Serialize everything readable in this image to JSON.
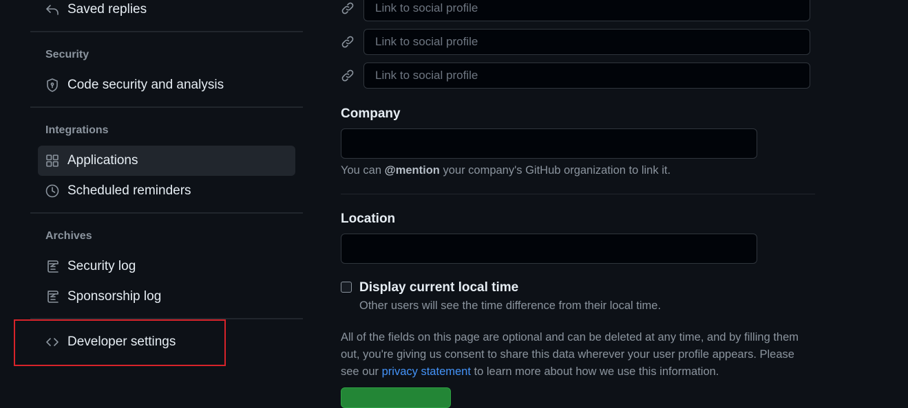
{
  "sidebar": {
    "saved_replies": "Saved replies",
    "sections": {
      "security": {
        "heading": "Security",
        "items": [
          "Code security and analysis"
        ]
      },
      "integrations": {
        "heading": "Integrations",
        "items": [
          "Applications",
          "Scheduled reminders"
        ]
      },
      "archives": {
        "heading": "Archives",
        "items": [
          "Security log",
          "Sponsorship log"
        ]
      }
    },
    "developer_settings": "Developer settings",
    "active_item": "Applications"
  },
  "profile": {
    "social_placeholder": "Link to social profile",
    "company": {
      "label": "Company",
      "help_prefix": "You can ",
      "help_mention": "@mention",
      "help_suffix": " your company's GitHub organization to link it."
    },
    "location": {
      "label": "Location"
    },
    "local_time": {
      "label": "Display current local time",
      "help": "Other users will see the time difference from their local time.",
      "checked": false
    },
    "disclaimer": {
      "prefix": "All of the fields on this page are optional and can be deleted at any time, and by filling them out, you're giving us consent to share this data wherever your user profile appears. Please see our ",
      "link": "privacy statement",
      "suffix": " to learn more about how we use this information."
    }
  },
  "icons": {
    "saved_replies": "reply-icon",
    "code_security": "shield-icon",
    "applications": "apps-grid-icon",
    "scheduled_reminders": "clock-icon",
    "security_log": "log-icon",
    "sponsorship_log": "log-icon",
    "developer_settings": "code-icon",
    "social_link": "link-icon"
  },
  "colors": {
    "background": "#0d1117",
    "input_background": "#010409",
    "link": "#4493f8",
    "highlight": "#d8232a",
    "primary_button": "#238636"
  }
}
